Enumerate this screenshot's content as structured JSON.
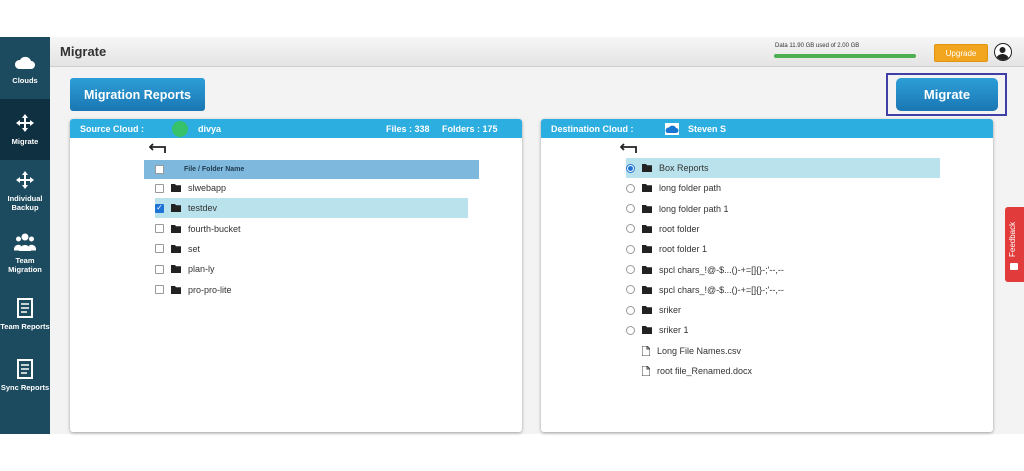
{
  "sidebar": {
    "items": [
      {
        "label": "Clouds",
        "icon": "cloud-icon"
      },
      {
        "label": "Migrate",
        "icon": "move-arrows-icon"
      },
      {
        "label": "Individual Backup",
        "icon": "move-arrows-icon"
      },
      {
        "label": "Team Migration",
        "icon": "team-icon"
      },
      {
        "label": "Team Reports",
        "icon": "report-icon"
      },
      {
        "label": "Sync Reports",
        "icon": "report-icon"
      }
    ]
  },
  "header": {
    "title": "Migrate",
    "usage_text": "Data 11.90 GB used of 2.00 GB",
    "usage_fraction": 1.0,
    "upgrade_label": "Upgrade"
  },
  "toolbar": {
    "reports_label": "Migration Reports",
    "migrate_label": "Migrate"
  },
  "source": {
    "label": "Source Cloud :",
    "name": "divya",
    "files": "Files : 338",
    "folders": "Folders : 175",
    "column_header": "File / Folder Name",
    "items": [
      {
        "name": "slwebapp",
        "checked": false
      },
      {
        "name": "testdev",
        "checked": true
      },
      {
        "name": "fourth-bucket",
        "checked": false
      },
      {
        "name": "set",
        "checked": false
      },
      {
        "name": "plan-ly",
        "checked": false
      },
      {
        "name": "pro-pro-lite",
        "checked": false
      }
    ]
  },
  "destination": {
    "label": "Destination Cloud :",
    "name": "Steven S",
    "folders": [
      {
        "name": "Box Reports",
        "selected": true
      },
      {
        "name": "long folder path",
        "selected": false
      },
      {
        "name": "long folder path 1",
        "selected": false
      },
      {
        "name": "root folder",
        "selected": false
      },
      {
        "name": "root folder 1",
        "selected": false
      },
      {
        "name": "spcl chars_!@-$...()-+=[]{}-;'--,--",
        "selected": false
      },
      {
        "name": "spcl chars_!@-$...()-+=[]{}-;'--,--",
        "selected": false
      },
      {
        "name": "sriker",
        "selected": false
      },
      {
        "name": "sriker 1",
        "selected": false
      }
    ],
    "files": [
      "Long File Names.csv",
      "root file_Renamed.docx"
    ]
  },
  "feedback_label": "Feedback",
  "colors": {
    "sidebar": "#1c4a5e",
    "panel_header": "#2daee0",
    "button": "#1a77b3",
    "upgrade": "#f2a51e",
    "feedback": "#e23b3b",
    "highlight": "#b9e2ec"
  }
}
